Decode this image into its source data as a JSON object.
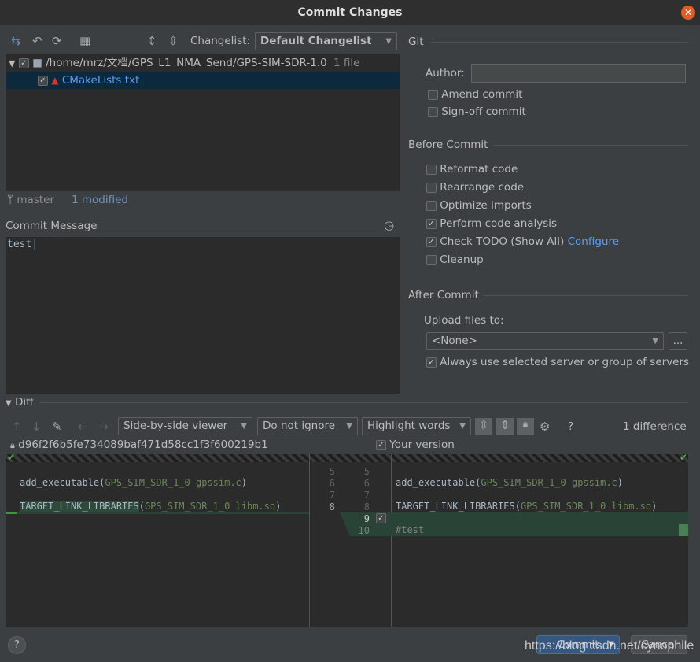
{
  "window": {
    "title": "Commit Changes",
    "close_icon": "close-icon"
  },
  "toolbar": {
    "changelist_label": "Changelist:",
    "changelist_value": "Default Changelist"
  },
  "tree": {
    "root_path": "/home/mrz/文档/GPS_L1_NMA_Send/GPS-SIM-SDR-1.0",
    "root_count": "1 file",
    "file": "CMakeLists.txt"
  },
  "status": {
    "branch": "master",
    "modified": "1 modified"
  },
  "commit_message": {
    "label": "Commit Message",
    "value": "test"
  },
  "git": {
    "title": "Git",
    "author_label": "Author:",
    "author_value": "",
    "amend": "Amend commit",
    "signoff": "Sign-off commit"
  },
  "before": {
    "title": "Before Commit",
    "options": [
      {
        "label": "Reformat code",
        "checked": false
      },
      {
        "label": "Rearrange code",
        "checked": false
      },
      {
        "label": "Optimize imports",
        "checked": false
      },
      {
        "label": "Perform code analysis",
        "checked": true
      },
      {
        "label": "Check TODO (Show All)",
        "checked": true
      },
      {
        "label": "Cleanup",
        "checked": false
      }
    ],
    "configure": "Configure"
  },
  "after": {
    "title": "After Commit",
    "upload_label": "Upload files to:",
    "upload_value": "<None>",
    "browse": "...",
    "always": "Always use selected server or group of servers"
  },
  "diff": {
    "title": "Diff",
    "viewer": "Side-by-side viewer",
    "ignore": "Do not ignore",
    "highlight": "Highlight words",
    "help": "?",
    "count": "1 difference",
    "left_rev": "d96f2f6b5fe734089baf471d58cc1f3f600219b1",
    "right_rev": "Your version",
    "left_lines": [
      "5",
      "6",
      "7",
      "8"
    ],
    "right_lines": [
      "5",
      "6",
      "7",
      "8",
      "9",
      "10"
    ],
    "code": {
      "l6a": "add_executable(",
      "l6b": "GPS_SIM_SDR_1_0 gpssim.c",
      "l6c": ")",
      "l8a": "TARGET_LINK_LIBRARIES",
      "l8b": "(",
      "l8c": "GPS_SIM_SDR_1_0 libm.so",
      "l8d": ")",
      "l10": "#test"
    }
  },
  "footer": {
    "help": "?",
    "commit": "Commit",
    "cancel": "Cancel",
    "watermark": "https://blog.csdn.net/cynophile"
  },
  "colors": {
    "accent": "#589df6",
    "added": "#294436",
    "commit_button": "#365880"
  }
}
